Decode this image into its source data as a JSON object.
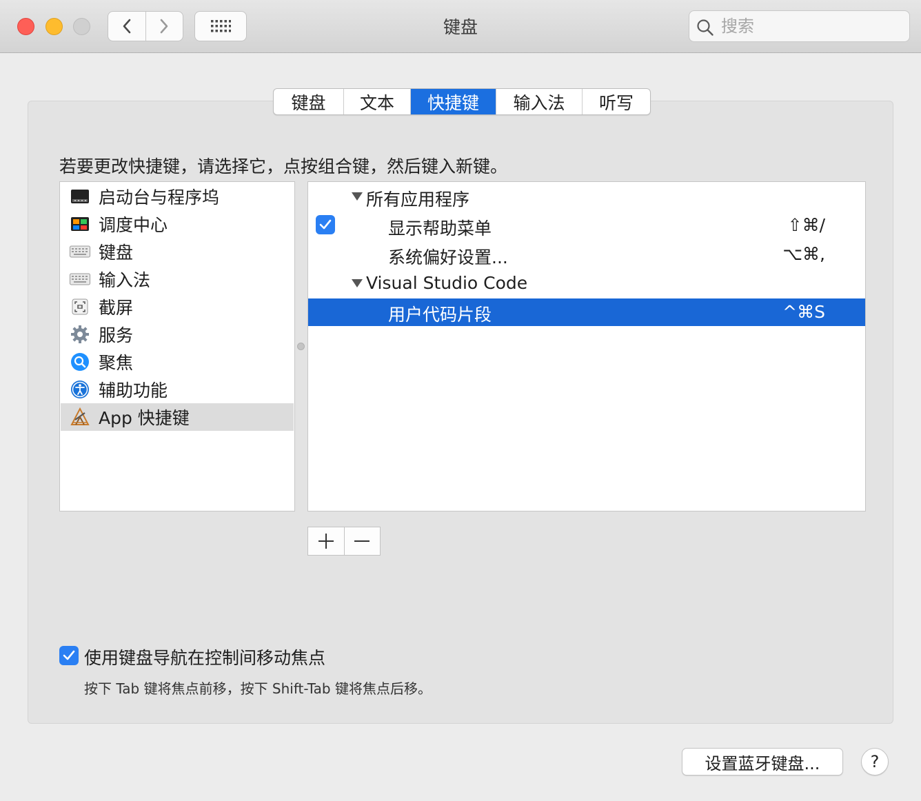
{
  "window": {
    "title": "键盘",
    "search_placeholder": "搜索"
  },
  "tabs": [
    {
      "label": "键盘",
      "active": false
    },
    {
      "label": "文本",
      "active": false
    },
    {
      "label": "快捷键",
      "active": true
    },
    {
      "label": "输入法",
      "active": false
    },
    {
      "label": "听写",
      "active": false
    }
  ],
  "instruction": "若要更改快捷键，请选择它，点按组合键，然后键入新键。",
  "categories": [
    {
      "label": "启动台与程序坞",
      "icon": "launchpad-dock-icon",
      "selected": false
    },
    {
      "label": "调度中心",
      "icon": "mission-control-icon",
      "selected": false
    },
    {
      "label": "键盘",
      "icon": "keyboard-icon",
      "selected": false
    },
    {
      "label": "输入法",
      "icon": "input-method-icon",
      "selected": false
    },
    {
      "label": "截屏",
      "icon": "screenshot-icon",
      "selected": false
    },
    {
      "label": "服务",
      "icon": "gear-icon",
      "selected": false
    },
    {
      "label": "聚焦",
      "icon": "spotlight-icon",
      "selected": false
    },
    {
      "label": "辅助功能",
      "icon": "accessibility-icon",
      "selected": false
    },
    {
      "label": "App 快捷键",
      "icon": "app-shortcuts-icon",
      "selected": true
    }
  ],
  "shortcuts": {
    "group1": {
      "label": "所有应用程序"
    },
    "item1": {
      "label": "显示帮助菜单",
      "key": "⇧⌘/",
      "checked": true
    },
    "item2": {
      "label": "系统偏好设置...",
      "key": "⌥⌘,"
    },
    "group2": {
      "label": "Visual Studio Code"
    },
    "item3": {
      "label": "用户代码片段",
      "key": "^⌘S",
      "selected": true
    }
  },
  "add_label": "+",
  "remove_label": "−",
  "keyboard_nav": {
    "label": "使用键盘导航在控制间移动焦点",
    "checked": true,
    "hint": "按下 Tab 键将焦点前移，按下 Shift-Tab 键将焦点后移。"
  },
  "bluetooth_button": "设置蓝牙键盘...",
  "help_button": "?",
  "colors": {
    "accent": "#1b6fe0",
    "selection": "#1967d6",
    "checkbox": "#2a7ff3"
  }
}
